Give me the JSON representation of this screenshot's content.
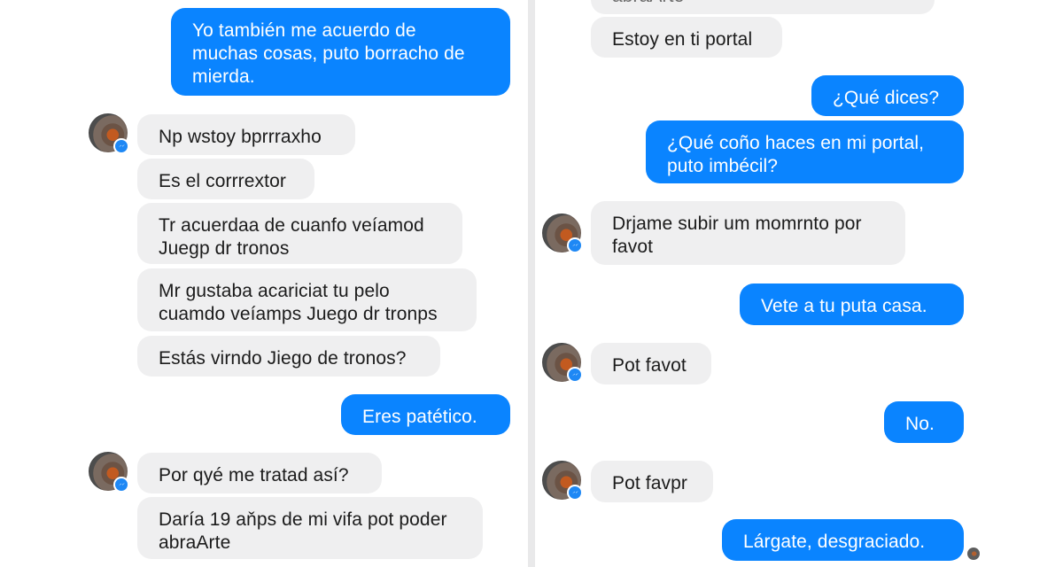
{
  "left_panel": {
    "messages": [
      {
        "text": "Yo también me acuerdo de\nmuchas cosas, puto borracho de\nmierda."
      },
      {
        "text": "Np wstoy bprrraxho"
      },
      {
        "text": "Es el corrrextor"
      },
      {
        "text": "Tr acuerdaa de cuanfo veíamod\nJuegp dr tronos"
      },
      {
        "text": "Mr gustaba acariciat tu pelo\ncuamdo veíamps Juego dr tronps"
      },
      {
        "text": "Estás virndo Jiego de tronos?"
      },
      {
        "text": "Eres patético."
      },
      {
        "text": "Por qyé me tratad así?"
      },
      {
        "text": "Daría 19 aňps de mi vifa pot poder\nabraArte"
      }
    ]
  },
  "right_panel": {
    "messages": [
      {
        "text": "abraArte"
      },
      {
        "text": "Estoy en ti portal"
      },
      {
        "text": "¿Qué dices?"
      },
      {
        "text": "¿Qué coño haces en mi portal,\nputo imbécil?"
      },
      {
        "text": "Drjame subir um momrnto por\nfavot"
      },
      {
        "text": "Vete a tu puta casa."
      },
      {
        "text": "Pot favot"
      },
      {
        "text": "No."
      },
      {
        "text": "Pot favpr"
      },
      {
        "text": "Lárgate, desgraciado."
      }
    ]
  },
  "colors": {
    "outgoing_bubble": "#0a84ff",
    "incoming_bubble": "#efeff0",
    "messenger_badge": "#1e88f5"
  },
  "icons": {
    "contact_avatar": "contact-avatar",
    "badge": "messenger-badge-icon",
    "read_receipt": "read-receipt-avatar"
  }
}
